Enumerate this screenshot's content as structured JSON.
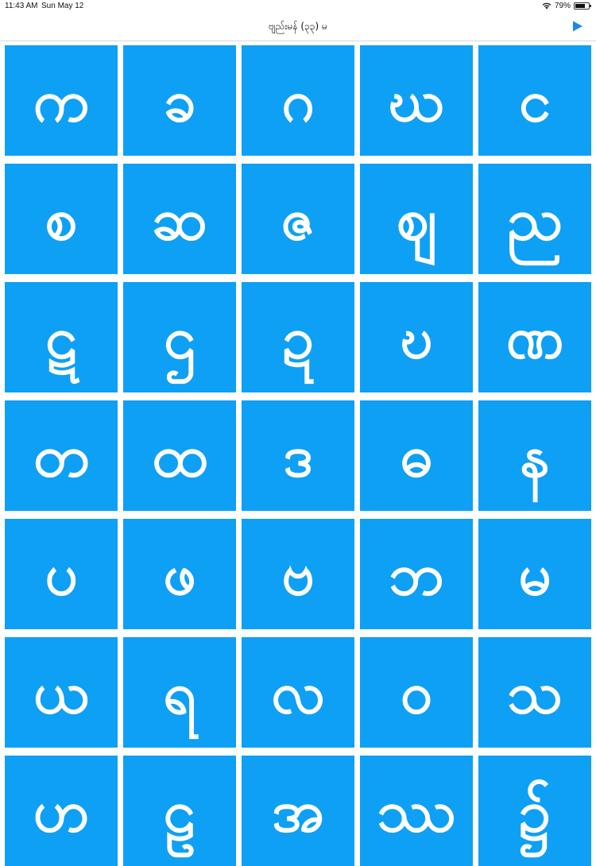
{
  "status_bar": {
    "time": "11:43 AM",
    "date": "Sun May 12",
    "battery_percent": "79%",
    "battery_level": 0.79,
    "wifi_icon": "wifi-icon",
    "battery_icon": "battery-icon"
  },
  "nav": {
    "title": "ဗျည်းမန် (၃၃) မ",
    "play_icon": "play-icon",
    "accent_color": "#1e86e6"
  },
  "tile_color": "#0ea0f5",
  "letters": [
    "က",
    "ခ",
    "ဂ",
    "ဃ",
    "င",
    "စ",
    "ဆ",
    "ဇ",
    "ဈ",
    "ည",
    "ဋ",
    "ဌ",
    "ဍ",
    "ဎ",
    "ဏ",
    "တ",
    "ထ",
    "ဒ",
    "ဓ",
    "န",
    "ပ",
    "ဖ",
    "ဗ",
    "ဘ",
    "မ",
    "ယ",
    "ရ",
    "လ",
    "ဝ",
    "သ",
    "ဟ",
    "ဠ",
    "အ",
    "ဿ",
    "၌"
  ]
}
